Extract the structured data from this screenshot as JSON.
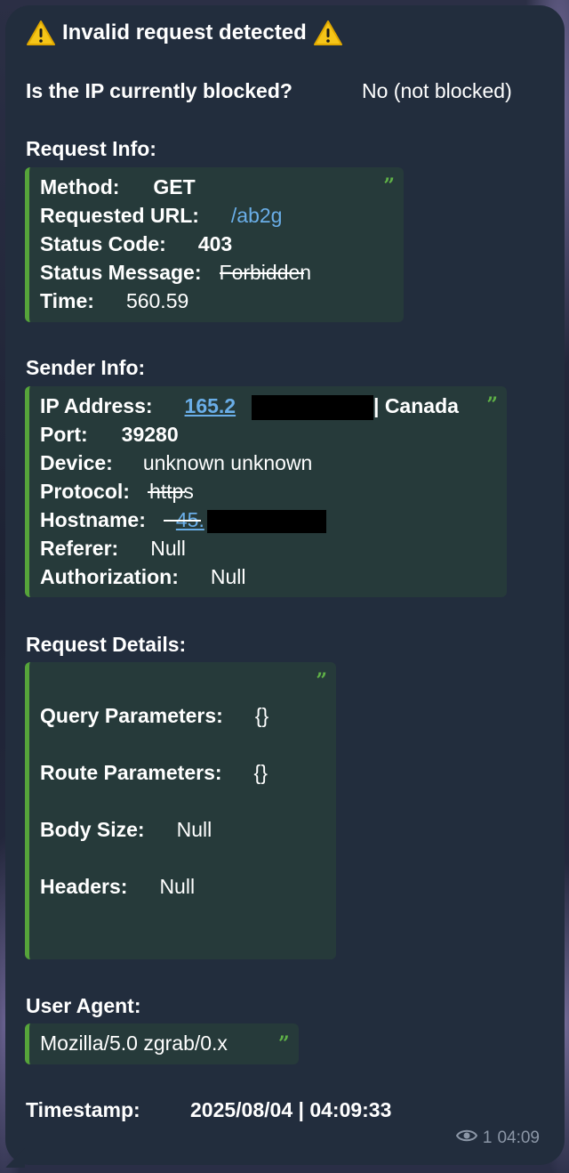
{
  "header": {
    "title": "Invalid request detected",
    "warning_icon": "warning-icon"
  },
  "blocked": {
    "question": "Is the IP currently blocked?",
    "answer": "No (not blocked)"
  },
  "request_info": {
    "label": "Request Info:",
    "method_key": "Method:",
    "method_val": "GET",
    "url_key": "Requested URL:",
    "url_val": "/ab2g",
    "status_code_key": "Status Code:",
    "status_code_val": "403",
    "status_message_key": "Status Message:",
    "status_message_val": "Forbidden",
    "time_key": "Time:",
    "time_val": "560.59"
  },
  "sender_info": {
    "label": "Sender Info:",
    "ip_key": "IP Address:",
    "ip_val_visible": "165.2",
    "ip_country": "| Canada",
    "port_key": "Port:",
    "port_val": "39280",
    "device_key": "Device:",
    "device_val": "unknown unknown",
    "protocol_key": "Protocol:",
    "protocol_val": "https",
    "hostname_key": "Hostname:",
    "hostname_val_visible": "45.",
    "referer_key": "Referer:",
    "referer_val": "Null",
    "authorization_key": "Authorization:",
    "authorization_val": "Null"
  },
  "request_details": {
    "label": "Request Details:",
    "query_key": "Query Parameters:",
    "query_val": "{}",
    "route_key": "Route Parameters:",
    "route_val": "{}",
    "body_key": "Body Size:",
    "body_val": "Null",
    "headers_key": "Headers:",
    "headers_val": "Null"
  },
  "user_agent": {
    "label": "User Agent:",
    "value": "Mozilla/5.0 zgrab/0.x"
  },
  "timestamp": {
    "label": "Timestamp:",
    "value": "2025/08/04 | 04:09:33"
  },
  "footer": {
    "views": "1",
    "time": "04:09"
  },
  "colors": {
    "bubble": "#222d3d",
    "quote_bg": "#263a3a",
    "quote_bar": "#56a43a",
    "link": "#6aaee8",
    "meta": "#8b96a6"
  }
}
